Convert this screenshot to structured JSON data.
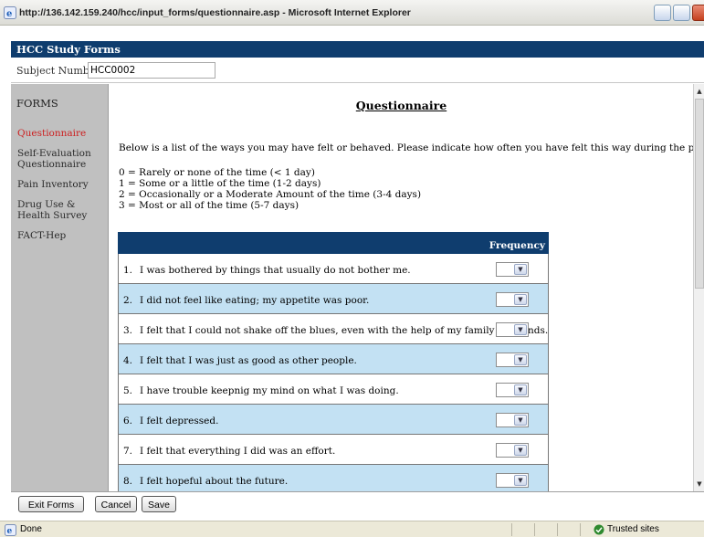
{
  "window": {
    "title": "http://136.142.159.240/hcc/input_forms/questionnaire.asp - Microsoft Internet Explorer"
  },
  "app": {
    "header": "HCC Study Forms",
    "subject_label": "Subject Number:",
    "subject_value": "HCC0002"
  },
  "sidebar": {
    "title": "FORMS",
    "items": [
      {
        "label": "Questionnaire",
        "active": true
      },
      {
        "label": "Self-Evaluation Questionnaire",
        "active": false
      },
      {
        "label": "Pain Inventory",
        "active": false
      },
      {
        "label": "Drug Use & Health Survey",
        "active": false
      },
      {
        "label": "FACT-Hep",
        "active": false
      }
    ]
  },
  "main": {
    "title": "Questionnaire",
    "intro": "Below is a list of the ways you may have felt or behaved. Please indicate how often you have felt this way during the past week.",
    "scale": [
      "0 = Rarely or none of the time (< 1 day)",
      "1 = Some or a little of the time (1-2 days)",
      "2 = Occasionally or a Moderate Amount of the time (3-4 days)",
      "3 = Most or all of the time (5-7 days)"
    ],
    "table_header": "Frequency",
    "questions": [
      {
        "num": "1.",
        "text": "I was bothered by things that usually do not bother me."
      },
      {
        "num": "2.",
        "text": "I did not feel like eating; my appetite was poor."
      },
      {
        "num": "3.",
        "text": "I felt that I could not shake off the blues, even with the help of my family or friends."
      },
      {
        "num": "4.",
        "text": "I felt that I was just as good as other people."
      },
      {
        "num": "5.",
        "text": "I have trouble keepnig my mind on what I was doing."
      },
      {
        "num": "6.",
        "text": "I felt depressed."
      },
      {
        "num": "7.",
        "text": "I felt that everything I did was an effort."
      },
      {
        "num": "8.",
        "text": "I felt hopeful about the future."
      }
    ]
  },
  "footer": {
    "exit_label": "Exit Forms",
    "cancel_label": "Cancel",
    "save_label": "Save"
  },
  "statusbar": {
    "status": "Done",
    "zone": "Trusted sites"
  },
  "colors": {
    "header_bg": "#0f3d6e",
    "sidebar_bg": "#c0c0c0",
    "row_alt": "#c3e1f3",
    "active_link": "#cc1f1f"
  }
}
